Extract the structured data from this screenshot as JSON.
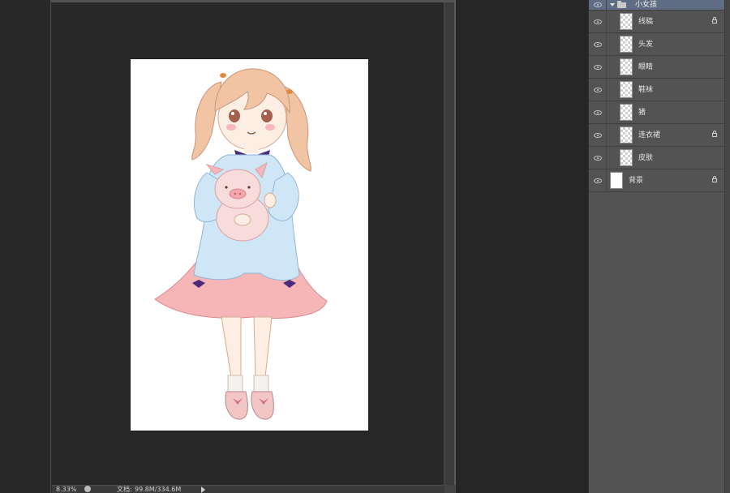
{
  "document": {
    "zoom": "8.33%",
    "doc_size_label": "文档:",
    "doc_size_value": "99.8M/334.6M"
  },
  "layers_panel": {
    "group": {
      "name": "小女孩",
      "expanded": true
    },
    "layers": [
      {
        "name": "线稿",
        "locked": true
      },
      {
        "name": "头发",
        "locked": false
      },
      {
        "name": "眼睛",
        "locked": false
      },
      {
        "name": "鞋袜",
        "locked": false
      },
      {
        "name": "猪",
        "locked": false
      },
      {
        "name": "连衣裙",
        "locked": true
      },
      {
        "name": "皮肤",
        "locked": false
      }
    ],
    "background_layer": {
      "name": "背景",
      "locked": true
    }
  },
  "colors": {
    "app_background": "#262626",
    "panel_background": "#535353",
    "group_highlight": "#5f6d84",
    "hair": "#f1c4a4",
    "dress_top": "#cfe6f7",
    "skirt": "#f6b6b8",
    "pig": "#f8dcdc"
  }
}
